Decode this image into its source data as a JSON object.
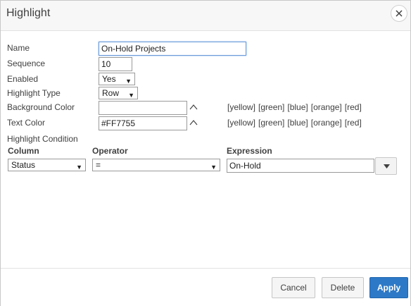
{
  "dialog": {
    "title": "Highlight",
    "close_icon": "close-icon"
  },
  "form": {
    "name": {
      "label": "Name",
      "value": "On-Hold Projects"
    },
    "sequence": {
      "label": "Sequence",
      "value": "10"
    },
    "enabled": {
      "label": "Enabled",
      "value": "Yes"
    },
    "highlight_type": {
      "label": "Highlight Type",
      "value": "Row"
    },
    "background_color": {
      "label": "Background Color",
      "value": "",
      "swatches": [
        "[yellow]",
        "[green]",
        "[blue]",
        "[orange]",
        "[red]"
      ]
    },
    "text_color": {
      "label": "Text Color",
      "value": "#FF7755",
      "swatches": [
        "[yellow]",
        "[green]",
        "[blue]",
        "[orange]",
        "[red]"
      ]
    },
    "condition": {
      "label": "Highlight Condition",
      "column_header": "Column",
      "operator_header": "Operator",
      "expression_header": "Expression",
      "column_value": "Status",
      "operator_value": "=",
      "expression_value": "On-Hold"
    }
  },
  "footer": {
    "cancel_label": "Cancel",
    "delete_label": "Delete",
    "apply_label": "Apply"
  },
  "colors": {
    "accent": "#2d79c7"
  }
}
